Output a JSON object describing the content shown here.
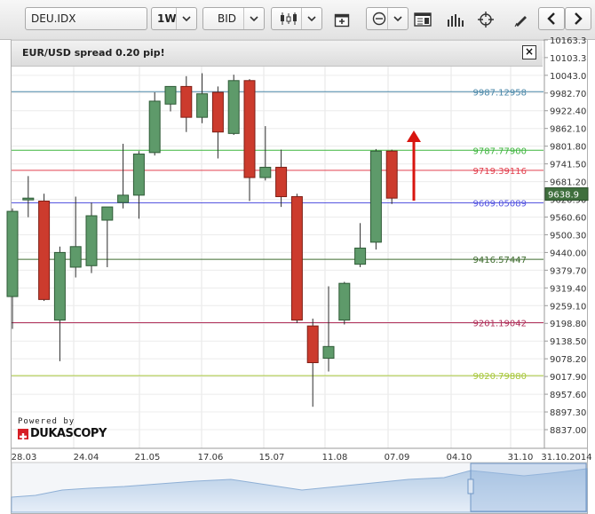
{
  "toolbar": {
    "instrument": "DEU.IDX",
    "period": "1W",
    "price_side": "BID"
  },
  "banner": {
    "title": "EUR/USD spread 0.20 pip!"
  },
  "branding": {
    "powered_by": "Powered by",
    "logo_text": "DUKASCOPY"
  },
  "chart_data": {
    "type": "candlestick",
    "y_axis_ticks": [
      10163.3,
      10103.3,
      10043.0,
      9982.7,
      9922.4,
      9862.1,
      9801.8,
      9741.5,
      9681.2,
      9620.9,
      9560.6,
      9500.3,
      9440.0,
      9379.7,
      9319.4,
      9259.1,
      9198.8,
      9138.5,
      9078.2,
      9017.9,
      8957.6,
      8897.3,
      8837.0
    ],
    "y_axis_labels": [
      "10163.3",
      "10103.3",
      "10043.0",
      "9982.70",
      "9922.40",
      "9862.10",
      "9801.80",
      "9741.50",
      "9681.20",
      "9620.90",
      "9560.60",
      "9500.30",
      "9440.00",
      "9379.70",
      "9319.40",
      "9259.10",
      "9198.80",
      "9138.50",
      "9078.20",
      "9017.90",
      "8957.60",
      "8897.30",
      "8837.00"
    ],
    "ylim": [
      8820,
      10170
    ],
    "x_axis_labels": [
      "28.03",
      "24.04",
      "21.05",
      "17.06",
      "15.07",
      "11.08",
      "07.09",
      "04.10",
      "31.10",
      "31.10.2014"
    ],
    "current_price": "9638.9",
    "horizontal_levels": [
      {
        "label": "9987.12958",
        "value": 9987.12958,
        "color": "#4a87a8"
      },
      {
        "label": "9787.77900",
        "value": 9787.779,
        "color": "#3fb53f"
      },
      {
        "label": "9719.39116",
        "value": 9719.39116,
        "color": "#e2414f"
      },
      {
        "label": "9609.05089",
        "value": 9609.05089,
        "color": "#5555e0"
      },
      {
        "label": "9416.57447",
        "value": 9416.57447,
        "color": "#3e6b2e"
      },
      {
        "label": "9201.19042",
        "value": 9201.19042,
        "color": "#b0305a"
      },
      {
        "label": "9020.79880",
        "value": 9020.7988,
        "color": "#a8c83a"
      }
    ],
    "candles": [
      {
        "open": 9290,
        "high": 9590,
        "low": 9180,
        "close": 9580
      },
      {
        "open": 9620,
        "high": 9700,
        "low": 9560,
        "close": 9625
      },
      {
        "open": 9615,
        "high": 9640,
        "low": 9275,
        "close": 9280
      },
      {
        "open": 9210,
        "high": 9460,
        "low": 9070,
        "close": 9440
      },
      {
        "open": 9390,
        "high": 9630,
        "low": 9355,
        "close": 9460
      },
      {
        "open": 9395,
        "high": 9610,
        "low": 9370,
        "close": 9565
      },
      {
        "open": 9550,
        "high": 9595,
        "low": 9390,
        "close": 9595
      },
      {
        "open": 9610,
        "high": 9810,
        "low": 9590,
        "close": 9635
      },
      {
        "open": 9635,
        "high": 9785,
        "low": 9555,
        "close": 9775
      },
      {
        "open": 9780,
        "high": 9985,
        "low": 9770,
        "close": 9955
      },
      {
        "open": 9945,
        "high": 10000,
        "low": 9920,
        "close": 10005
      },
      {
        "open": 10005,
        "high": 10040,
        "low": 9850,
        "close": 9900
      },
      {
        "open": 9900,
        "high": 10050,
        "low": 9880,
        "close": 9980
      },
      {
        "open": 9985,
        "high": 10005,
        "low": 9760,
        "close": 9850
      },
      {
        "open": 9845,
        "high": 10045,
        "low": 9840,
        "close": 10025
      },
      {
        "open": 10025,
        "high": 10030,
        "low": 9615,
        "close": 9695
      },
      {
        "open": 9695,
        "high": 9870,
        "low": 9685,
        "close": 9730
      },
      {
        "open": 9730,
        "high": 9790,
        "low": 9595,
        "close": 9630
      },
      {
        "open": 9630,
        "high": 9640,
        "low": 9200,
        "close": 9210
      },
      {
        "open": 9190,
        "high": 9215,
        "low": 8915,
        "close": 9065
      },
      {
        "open": 9080,
        "high": 9325,
        "low": 9035,
        "close": 9120
      },
      {
        "open": 9210,
        "high": 9340,
        "low": 9195,
        "close": 9335
      },
      {
        "open": 9400,
        "high": 9540,
        "low": 9390,
        "close": 9455
      },
      {
        "open": 9475,
        "high": 9792,
        "low": 9450,
        "close": 9785
      },
      {
        "open": 9785,
        "high": 9790,
        "low": 9605,
        "close": 9625
      }
    ]
  }
}
